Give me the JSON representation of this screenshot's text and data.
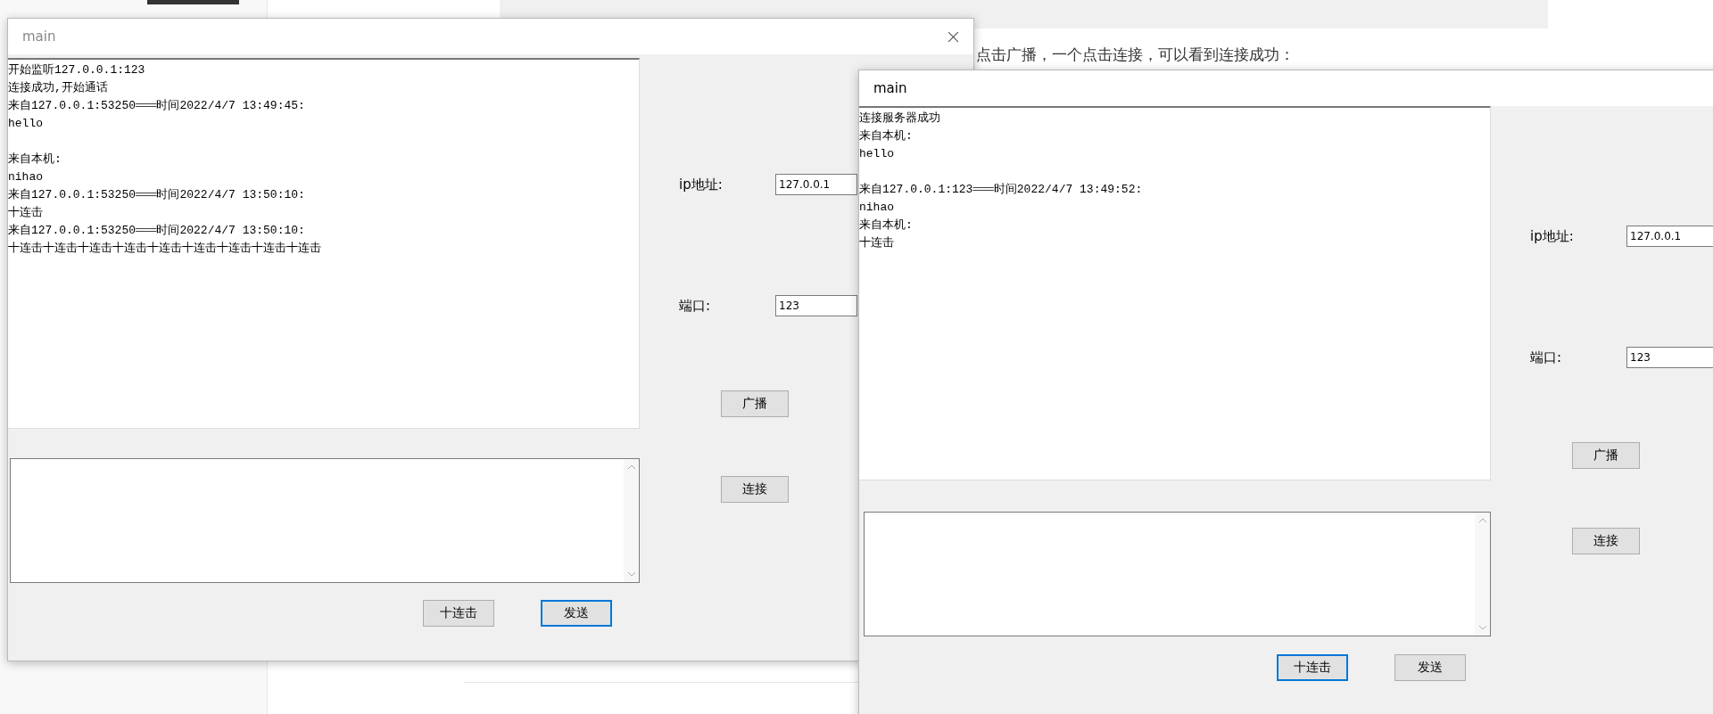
{
  "background_page": {
    "article_text": "点击广播，一个点击连接，可以看到连接成功："
  },
  "windows": [
    {
      "title": "main",
      "active": false,
      "log_blocks": [
        {
          "lines": [
            "开始监听127.0.0.1:123",
            "连接成功,开始通话",
            "来自127.0.0.1:53250═══时间2022/4/7 13:49:45:",
            "hello"
          ]
        },
        {
          "lines": [
            "来自本机:",
            "nihao",
            "来自127.0.0.1:53250═══时间2022/4/7 13:50:10:",
            "十连击",
            "来自127.0.0.1:53250═══时间2022/4/7 13:50:10:",
            "十连击十连击十连击十连击十连击十连击十连击十连击十连击"
          ]
        }
      ],
      "fields": [
        {
          "label": "ip地址:",
          "value": "127.0.0.1"
        },
        {
          "label": "端口:",
          "value": "123"
        }
      ],
      "side_buttons": [
        "广播",
        "连接"
      ],
      "bottom_buttons": [
        {
          "label": "十连击",
          "focused": false
        },
        {
          "label": "发送",
          "focused": true
        }
      ]
    },
    {
      "title": "main",
      "active": true,
      "log_blocks": [
        {
          "lines": [
            "连接服务器成功",
            "来自本机:",
            "hello"
          ]
        },
        {
          "lines": [
            "来自127.0.0.1:123═══时间2022/4/7 13:49:52:",
            "nihao",
            "来自本机:",
            "十连击"
          ]
        }
      ],
      "fields": [
        {
          "label": "ip地址:",
          "value": "127.0.0.1"
        },
        {
          "label": "端口:",
          "value": "123"
        }
      ],
      "side_buttons": [
        "广播",
        "连接"
      ],
      "bottom_buttons": [
        {
          "label": "十连击",
          "focused": true
        },
        {
          "label": "发送",
          "focused": false
        }
      ]
    }
  ]
}
